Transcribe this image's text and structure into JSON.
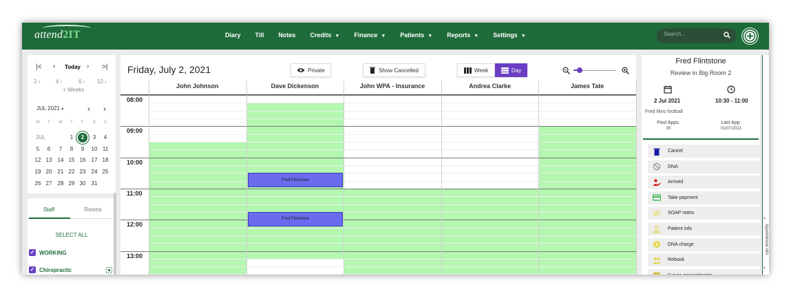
{
  "app": {
    "logo": "attend",
    "logo_accent": "2IT"
  },
  "nav": {
    "items": [
      {
        "label": "Diary",
        "dropdown": false
      },
      {
        "label": "Till",
        "dropdown": false
      },
      {
        "label": "Notes",
        "dropdown": false
      },
      {
        "label": "Credits",
        "dropdown": true
      },
      {
        "label": "Finance",
        "dropdown": true
      },
      {
        "label": "Patients",
        "dropdown": true
      },
      {
        "label": "Reports",
        "dropdown": true
      },
      {
        "label": "Settings",
        "dropdown": true
      }
    ],
    "search_placeholder": "Search..."
  },
  "mini_calendar": {
    "today_label": "Today",
    "week_jumps": [
      "2",
      "4",
      "6",
      "12"
    ],
    "plus_weeks": "+ Weeks",
    "month_label": "JUL 2021",
    "weekday_headers": [
      "M",
      "T",
      "W",
      "T",
      "F",
      "S",
      "S"
    ],
    "month_abbrev": "JUL",
    "weeks": [
      [
        "",
        "",
        "",
        "1",
        "2",
        "3",
        "4"
      ],
      [
        "5",
        "6",
        "7",
        "8",
        "9",
        "10",
        "11"
      ],
      [
        "12",
        "13",
        "14",
        "15",
        "16",
        "17",
        "18"
      ],
      [
        "19",
        "20",
        "21",
        "22",
        "23",
        "24",
        "25"
      ],
      [
        "26",
        "27",
        "28",
        "29",
        "30",
        "31",
        ""
      ]
    ],
    "selected_day": "2"
  },
  "staff_panel": {
    "tabs": [
      "Staff",
      "Rooms"
    ],
    "active_tab": "Staff",
    "select_all": "SELECT ALL",
    "groups": [
      {
        "label": "WORKING",
        "checked": true
      },
      {
        "label": "Chiropractic",
        "checked": true
      }
    ]
  },
  "calendar": {
    "date_title": "Friday, July 2, 2021",
    "private_label": "Private",
    "show_cancelled_label": "Show Cancelled",
    "view_week_label": "Week",
    "view_day_label": "Day",
    "active_view": "Day",
    "zoom_level": 0.15,
    "columns": [
      "John Johnson",
      "Dave Dickenson",
      "John WPA - Insurance",
      "Andrea Clarke",
      "James Tate"
    ],
    "hours": [
      "08:00",
      "09:00",
      "10:00",
      "11:00",
      "12:00",
      "13:00"
    ],
    "availability": [
      {
        "col": 0,
        "start": "09:30",
        "end": "14:00"
      },
      {
        "col": 1,
        "start": "08:15",
        "end": "13:15"
      },
      {
        "col": 2,
        "start": "11:00",
        "end": "14:00"
      },
      {
        "col": 3,
        "start": "11:00",
        "end": "14:00"
      },
      {
        "col": 4,
        "start": "09:00",
        "end": "14:00"
      }
    ],
    "appointments": [
      {
        "col": 1,
        "start": "10:30",
        "end": "11:00",
        "label": "Fred Flintstone"
      },
      {
        "col": 1,
        "start": "11:45",
        "end": "12:15",
        "label": "Fred Flintstone"
      }
    ]
  },
  "appointment_info": {
    "patient_name": "Fred Flintstone",
    "subtitle": "Review in Big Room 2",
    "date": "2 Jul 2021",
    "time": "10:30 - 11:00",
    "note": "Fred likes football",
    "past_apps_label": "Past Apps.",
    "past_apps_value": "35",
    "last_app_label": "Last App.",
    "last_app_value": "01/07/2021",
    "side_tab_label": "Appointment info",
    "actions": [
      {
        "label": "Cancel",
        "icon": "trash-icon",
        "color": "#1a1aa6"
      },
      {
        "label": "DNA",
        "icon": "block-icon",
        "color": "#888888"
      },
      {
        "label": "Arrived",
        "icon": "person-check-icon",
        "color": "#cc1a1a"
      },
      {
        "label": "Take payment",
        "icon": "card-icon",
        "color": "#2bb84a"
      },
      {
        "label": "SOAP notes",
        "icon": "lines-icon",
        "color": "#e6d64a"
      },
      {
        "label": "Patient info",
        "icon": "person-icon",
        "color": "#e6d64a"
      },
      {
        "label": "DNA charge",
        "icon": "coin-icon",
        "color": "#e6d64a"
      },
      {
        "label": "Rebook",
        "icon": "people-icon",
        "color": "#e6d64a"
      },
      {
        "label": "Future appointments",
        "icon": "calendar-icon",
        "color": "#e6d64a"
      }
    ]
  },
  "colors": {
    "brand": "#1e6b3a",
    "accent": "#6a3fc4",
    "available": "#b3f7b0",
    "appointment": "#6b6bef"
  }
}
